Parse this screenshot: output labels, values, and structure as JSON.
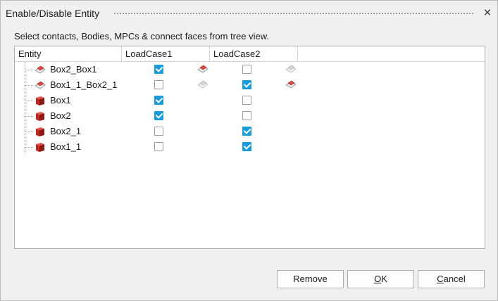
{
  "dialog": {
    "title": "Enable/Disable Entity",
    "instruction": "Select contacts, Bodies, MPCs & connect faces from tree view."
  },
  "tree": {
    "columns": [
      "Entity",
      "LoadCase1",
      "LoadCase2"
    ],
    "rows": [
      {
        "label": "Box2_Box1",
        "icon": "contact-icon",
        "lc1": true,
        "lc2": false,
        "lc1_contact_icon": "contact-active-icon",
        "lc2_contact_icon": "contact-inactive-icon"
      },
      {
        "label": "Box1_1_Box2_1",
        "icon": "contact-icon",
        "lc1": false,
        "lc2": true,
        "lc1_contact_icon": "contact-inactive-icon",
        "lc2_contact_icon": "contact-active-icon"
      },
      {
        "label": "Box1",
        "icon": "body-icon",
        "lc1": true,
        "lc2": false
      },
      {
        "label": "Box2",
        "icon": "body-icon",
        "lc1": true,
        "lc2": false
      },
      {
        "label": "Box2_1",
        "icon": "body-icon",
        "lc1": false,
        "lc2": true
      },
      {
        "label": "Box1_1",
        "icon": "body-icon",
        "lc1": false,
        "lc2": true
      }
    ]
  },
  "buttons": {
    "remove": "Remove",
    "ok_mnemonic": "O",
    "ok_rest": "K",
    "cancel_mnemonic": "C",
    "cancel_rest": "ancel"
  },
  "colors": {
    "checkbox_checked": "#1a9ad6",
    "body_icon": "#c0281f",
    "contact_icon": "#d9534f"
  }
}
